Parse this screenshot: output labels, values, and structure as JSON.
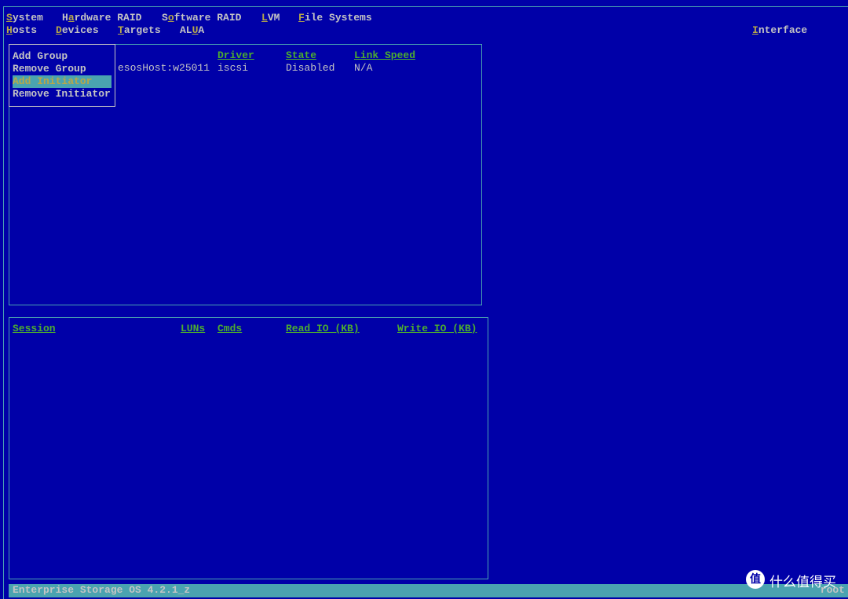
{
  "menubar": {
    "row1": [
      {
        "hot": "S",
        "rest": "ystem"
      },
      {
        "pre": "H",
        "hot": "a",
        "rest": "rdware RAID"
      },
      {
        "pre": "S",
        "hot": "o",
        "rest": "ftware RAID"
      },
      {
        "hot": "L",
        "rest": "VM"
      },
      {
        "hot": "F",
        "rest": "ile Systems"
      }
    ],
    "row2": [
      {
        "hot": "H",
        "rest": "osts"
      },
      {
        "hot": "D",
        "rest": "evices"
      },
      {
        "hot": "T",
        "rest": "argets"
      },
      {
        "pre": "AL",
        "hot": "U",
        "rest": "A"
      }
    ],
    "interface": {
      "hot": "I",
      "rest": "nterface"
    }
  },
  "hosts_menu": {
    "items": [
      "Add Group",
      "Remove Group",
      "Add Initiator",
      "Remove Initiator"
    ],
    "selected": "Add Initiator"
  },
  "targets_table": {
    "columns": [
      "Driver",
      "State",
      "Link Speed"
    ],
    "rows": [
      {
        "target": "esosHost:w25011",
        "driver": "iscsi",
        "state": "Disabled",
        "link_speed": "N/A"
      }
    ]
  },
  "sessions_table": {
    "columns": [
      "Session",
      "LUNs",
      "Cmds",
      "Read IO (KB)",
      "Write IO (KB)"
    ]
  },
  "status_bar": {
    "left": "Enterprise Storage OS 4.2.1_z",
    "right": "root"
  },
  "watermark": {
    "text": "什么值得买",
    "icon": "值"
  },
  "colors": {
    "background": "#0000a8",
    "accent": "#4aa3b0",
    "header": "#4cac30",
    "hotkey": "#b8a848",
    "text": "#c4c4c4"
  }
}
